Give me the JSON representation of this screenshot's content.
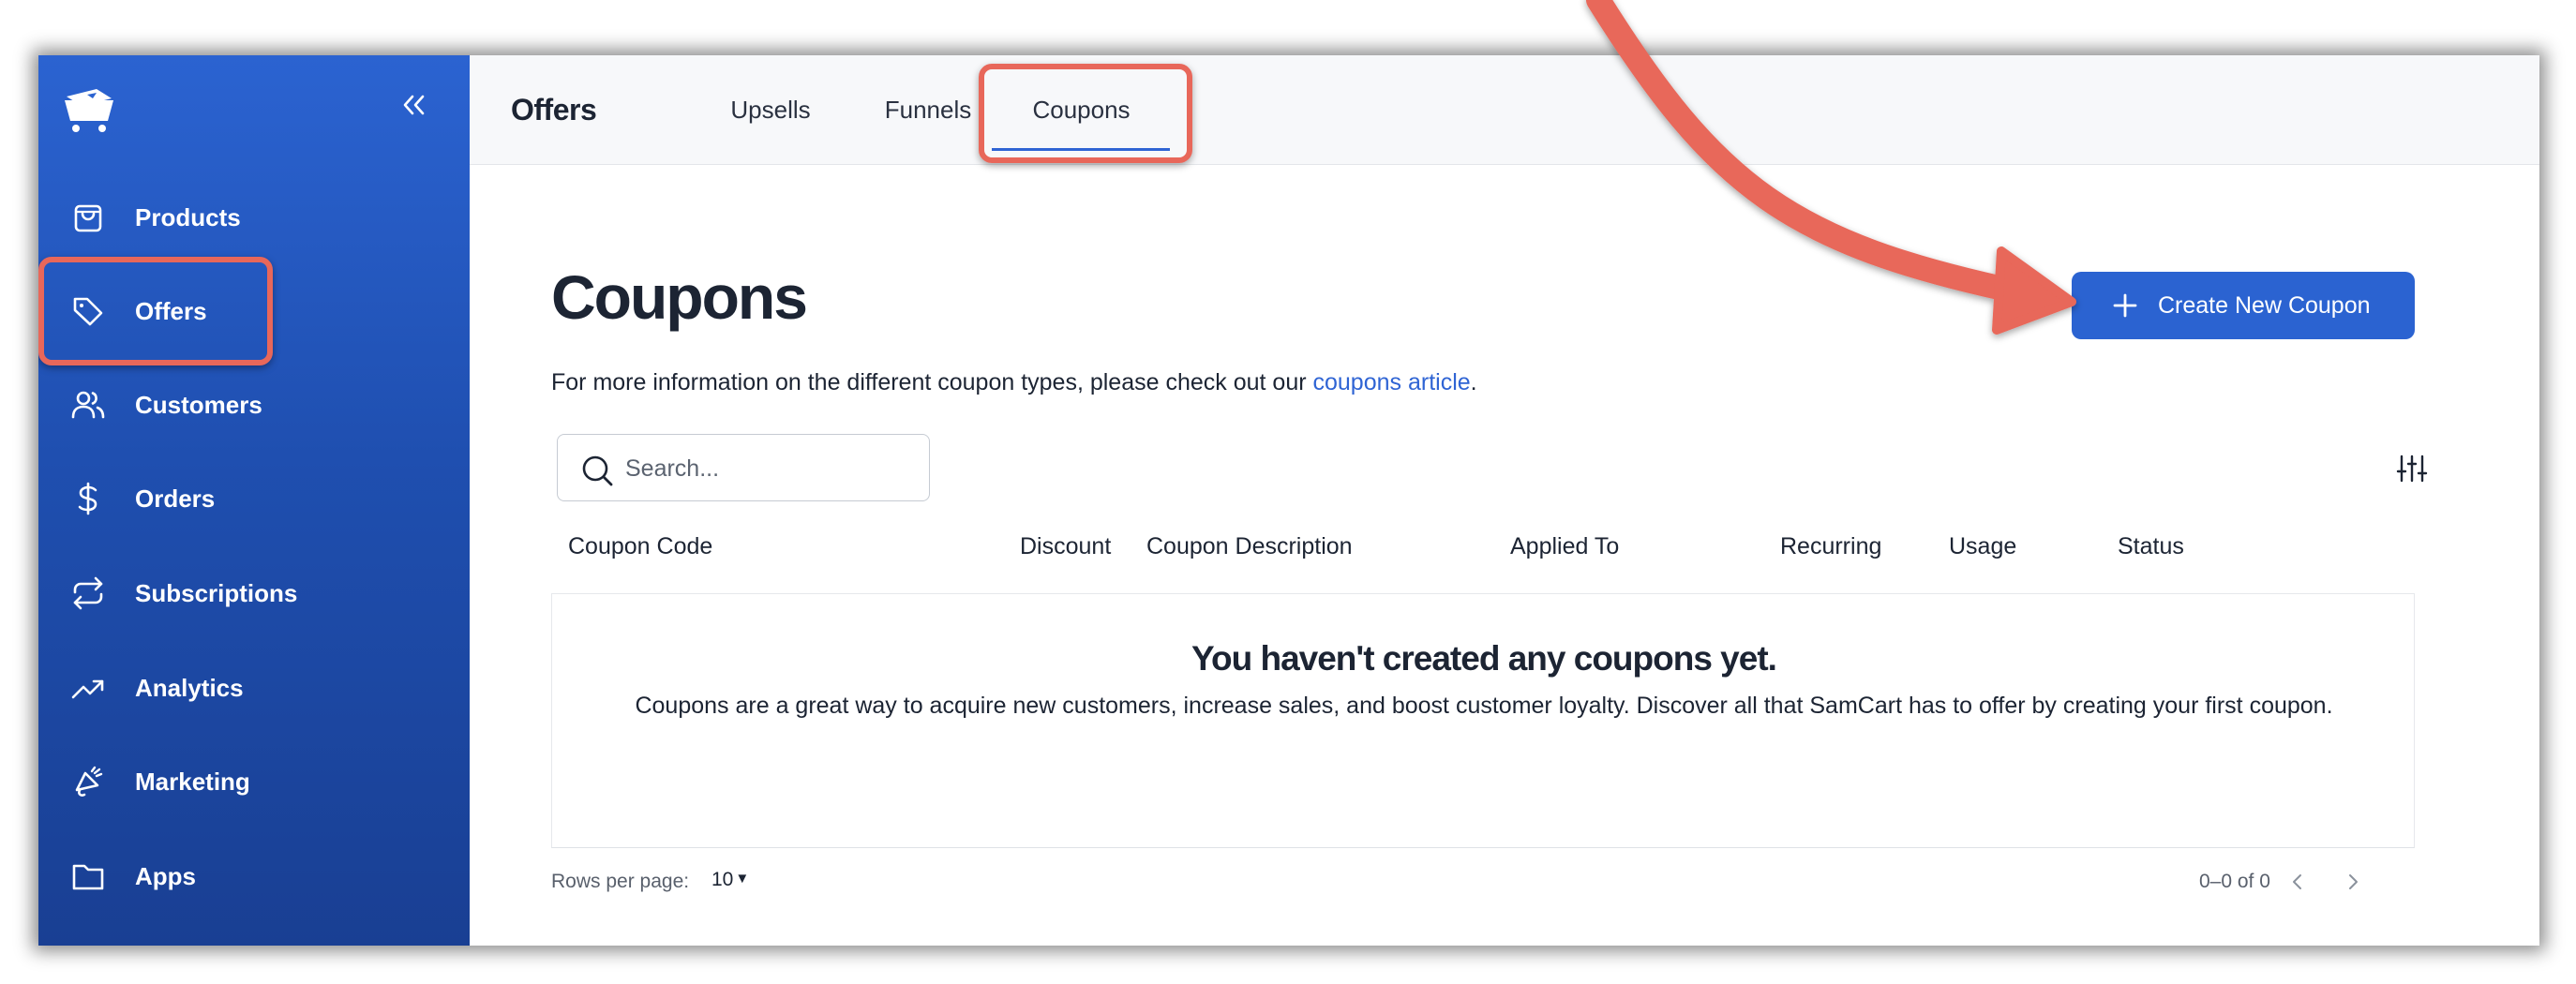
{
  "sidebar": {
    "items": [
      {
        "label": "Products",
        "icon": "shopping-bag-icon"
      },
      {
        "label": "Offers",
        "icon": "tag-icon"
      },
      {
        "label": "Customers",
        "icon": "users-icon"
      },
      {
        "label": "Orders",
        "icon": "dollar-icon"
      },
      {
        "label": "Subscriptions",
        "icon": "repeat-icon"
      },
      {
        "label": "Analytics",
        "icon": "trending-up-icon"
      },
      {
        "label": "Marketing",
        "icon": "megaphone-icon"
      },
      {
        "label": "Apps",
        "icon": "folder-icon"
      }
    ],
    "highlighted_item": "Offers"
  },
  "tabbar": {
    "title": "Offers",
    "tabs": [
      {
        "label": "Upsells",
        "active": false
      },
      {
        "label": "Funnels",
        "active": false
      },
      {
        "label": "Coupons",
        "active": true
      }
    ]
  },
  "page": {
    "title": "Coupons",
    "info_prefix": "For more information on the different coupon types, please check out our ",
    "info_link": "coupons article",
    "info_suffix": ".",
    "create_button": "Create New Coupon",
    "search_placeholder": "Search..."
  },
  "table": {
    "columns": [
      "Coupon Code",
      "Discount",
      "Coupon Description",
      "Applied To",
      "Recurring",
      "Usage",
      "Status"
    ],
    "empty_title": "You haven't created any coupons yet.",
    "empty_description": "Coupons are a great way to acquire new customers, increase sales, and boost customer loyalty. Discover all that SamCart has to offer by creating your first coupon."
  },
  "footer": {
    "rows_per_page_label": "Rows per page:",
    "rows_per_page_value": "10",
    "range_text": "0–0 of 0"
  },
  "colors": {
    "sidebar_top": "#2b63d1",
    "sidebar_bottom": "#193f93",
    "primary": "#2b63d1",
    "link": "#2f64d4",
    "annotation": "#e8675a"
  }
}
